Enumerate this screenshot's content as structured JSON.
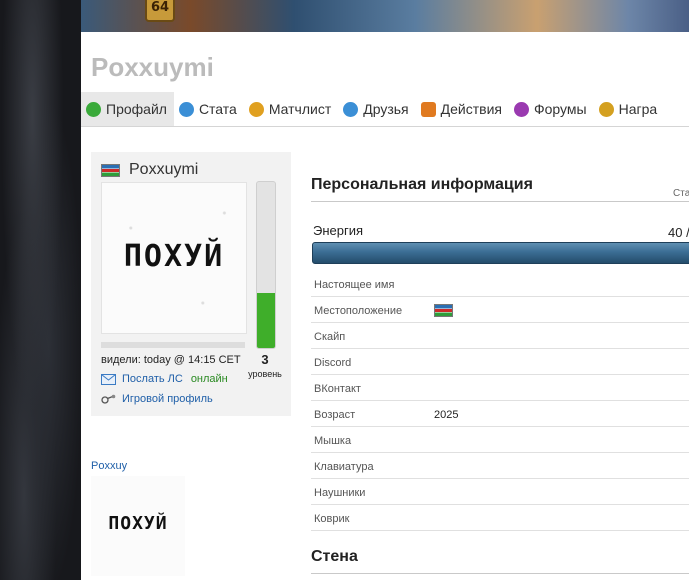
{
  "banner": {
    "badge": "64"
  },
  "profile": {
    "username": "Poxxuymi"
  },
  "tabs": [
    {
      "label": "Профайл",
      "icon": "profile-icon",
      "color": "#3aaa3a",
      "active": true
    },
    {
      "label": "Стата",
      "icon": "stats-icon",
      "color": "#3b8fd6"
    },
    {
      "label": "Матчлист",
      "icon": "matchlist-icon",
      "color": "#e0a020"
    },
    {
      "label": "Друзья",
      "icon": "friends-icon",
      "color": "#3b8fd6"
    },
    {
      "label": "Действия",
      "icon": "actions-icon",
      "color": "#e07a20"
    },
    {
      "label": "Форумы",
      "icon": "forums-icon",
      "color": "#9a3ab0"
    },
    {
      "label": "Награ",
      "icon": "awards-icon",
      "color": "#d4a020"
    }
  ],
  "card": {
    "name": "Poxxuymi",
    "avatar_text": "ПОХУЙ",
    "level": "3",
    "level_label": "уровень",
    "level_fill": 0.33,
    "seen": "видели: today @ 14:15 CET",
    "send_message": "Послать ЛС",
    "online": "онлайн",
    "game_profile": "Игровой профиль"
  },
  "friend": {
    "name": "Poxxuy",
    "avatar_text": "ПОХУЙ"
  },
  "personal": {
    "title": "Персональная информация",
    "sta": "Ста",
    "energy_label": "Энергия",
    "energy_value": "40 /",
    "rows": [
      {
        "label": "Настоящее имя",
        "value": ""
      },
      {
        "label": "Местоположение",
        "value": "",
        "flag": true
      },
      {
        "label": "Скайп",
        "value": ""
      },
      {
        "label": "Discord",
        "value": ""
      },
      {
        "label": "ВКонтакт",
        "value": ""
      },
      {
        "label": "Возраст",
        "value": "2025"
      },
      {
        "label": "Мышка",
        "value": ""
      },
      {
        "label": "Клавиатура",
        "value": ""
      },
      {
        "label": "Наушники",
        "value": ""
      },
      {
        "label": "Коврик",
        "value": ""
      }
    ]
  },
  "wall": {
    "title": "Стена"
  }
}
